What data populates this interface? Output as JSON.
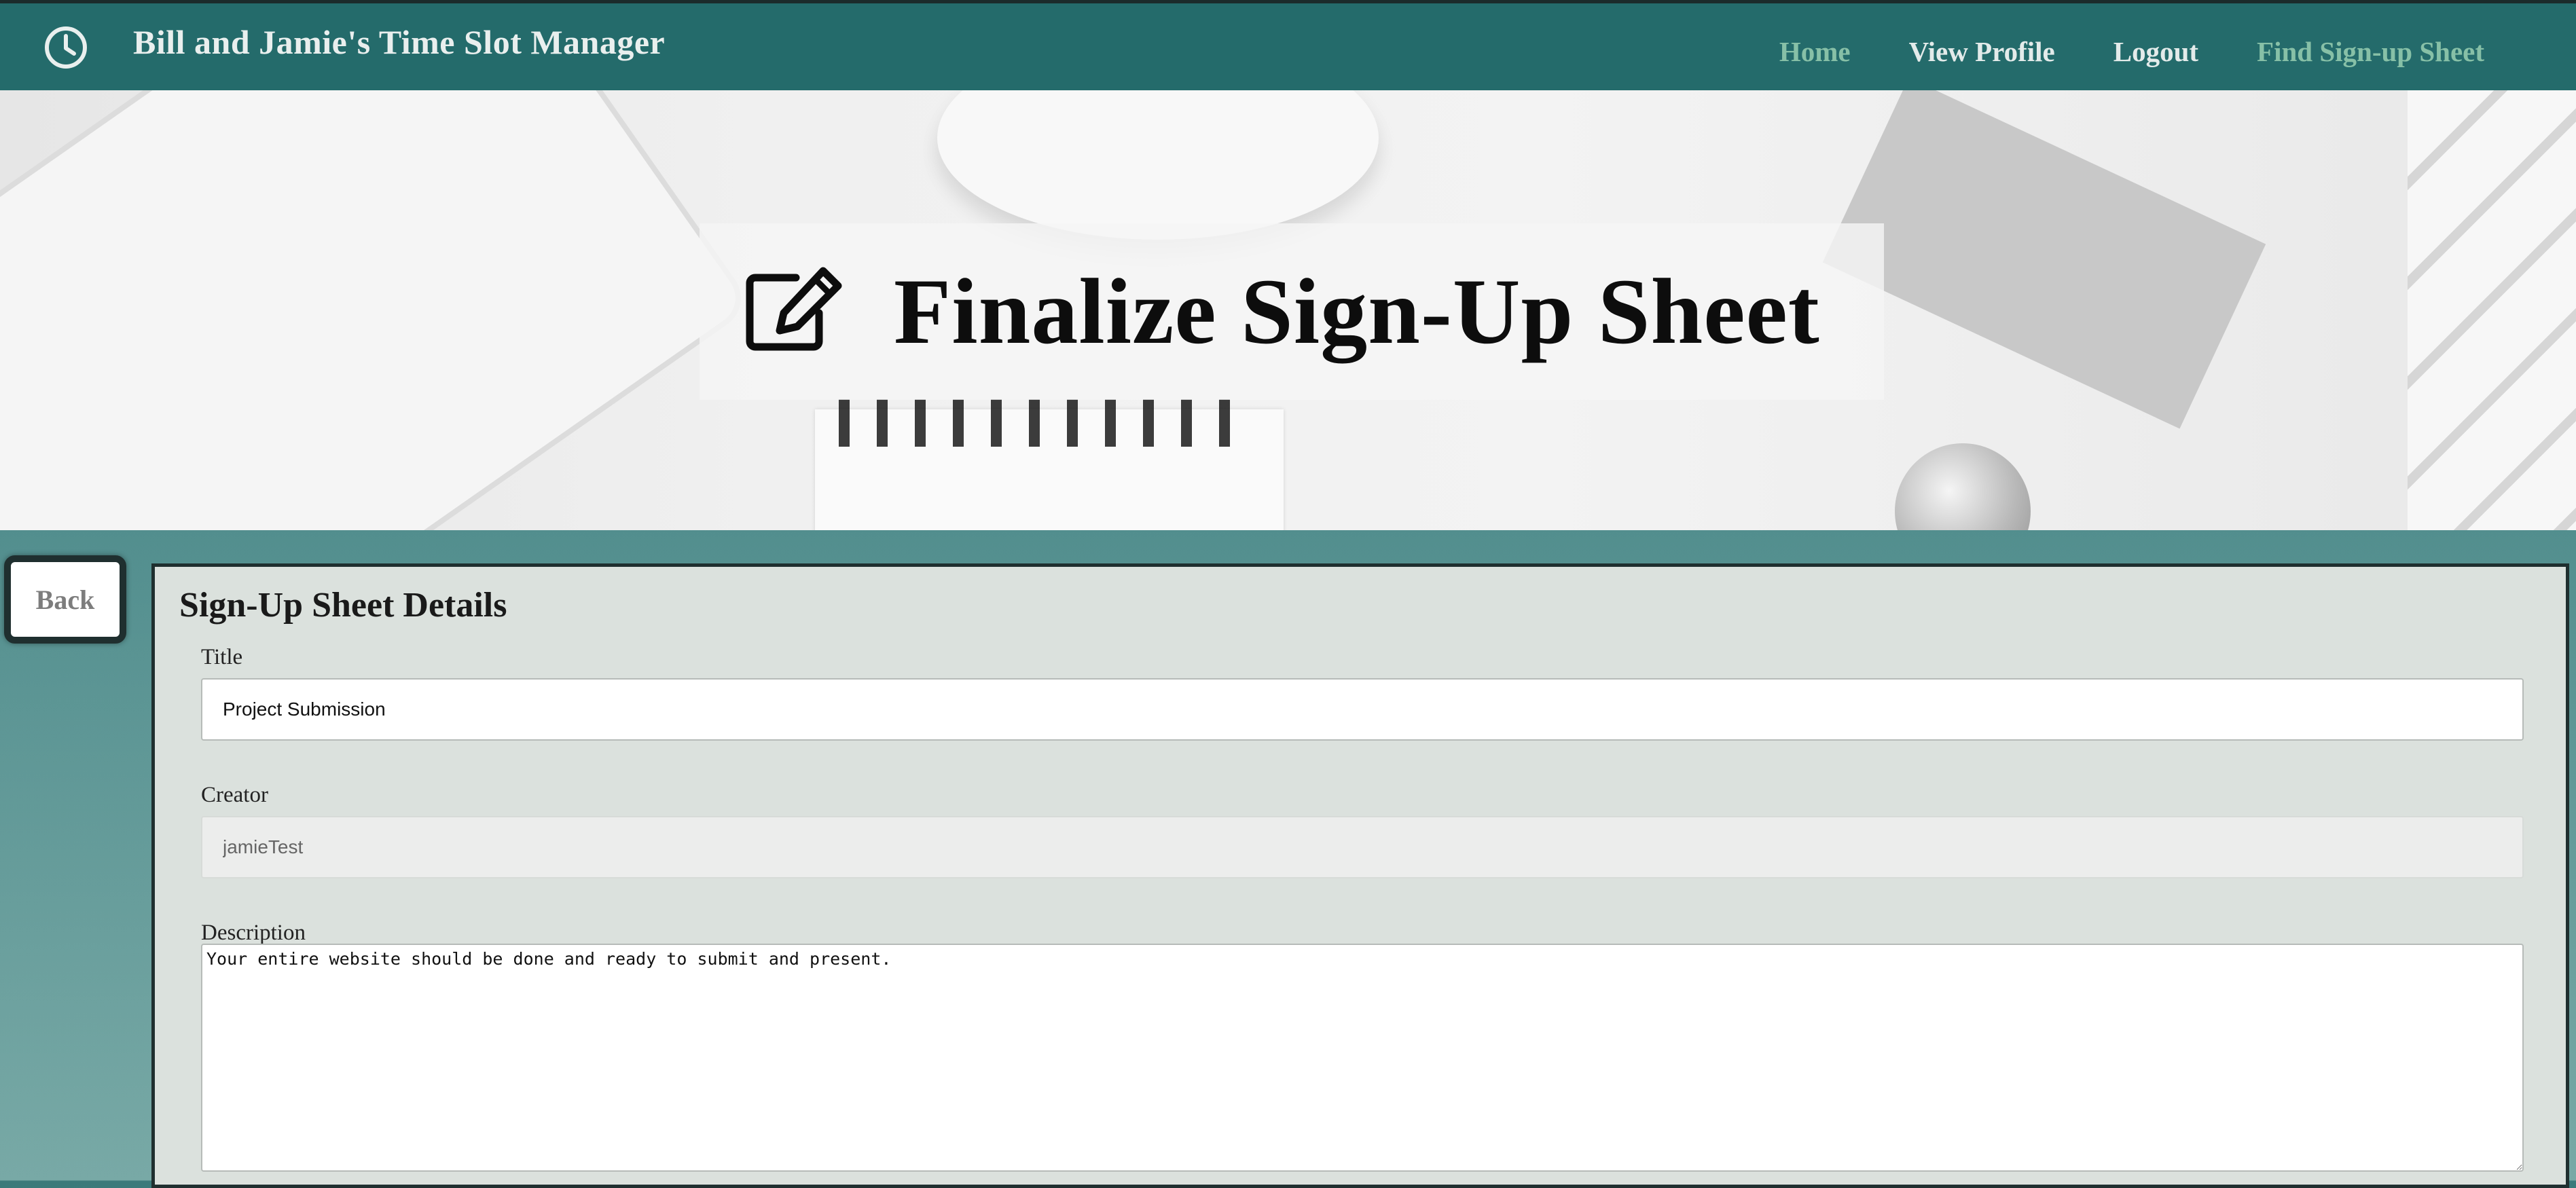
{
  "app": {
    "title": "Bill and Jamie's Time Slot Manager",
    "brand_icon": "clock-icon"
  },
  "nav": {
    "items": [
      {
        "label": "Home",
        "style": "muted"
      },
      {
        "label": "View Profile",
        "style": "bright"
      },
      {
        "label": "Logout",
        "style": "bright"
      },
      {
        "label": "Find Sign-up Sheet",
        "style": "muted"
      }
    ]
  },
  "hero": {
    "icon": "edit-icon",
    "title": "Finalize Sign-Up Sheet"
  },
  "back_button": {
    "label": "Back"
  },
  "details": {
    "heading": "Sign-Up Sheet Details",
    "title_label": "Title",
    "title_value": "Project Submission",
    "creator_label": "Creator",
    "creator_value": "jamieTest",
    "description_label": "Description",
    "description_value": "Your entire website should be done and ready to submit and present."
  },
  "colors": {
    "navbar": "#246b6b",
    "nav_muted": "#87c0a7",
    "nav_bright": "#e3ebea",
    "panel_bg": "#dbe1dd",
    "panel_border": "#1f2f2f"
  }
}
